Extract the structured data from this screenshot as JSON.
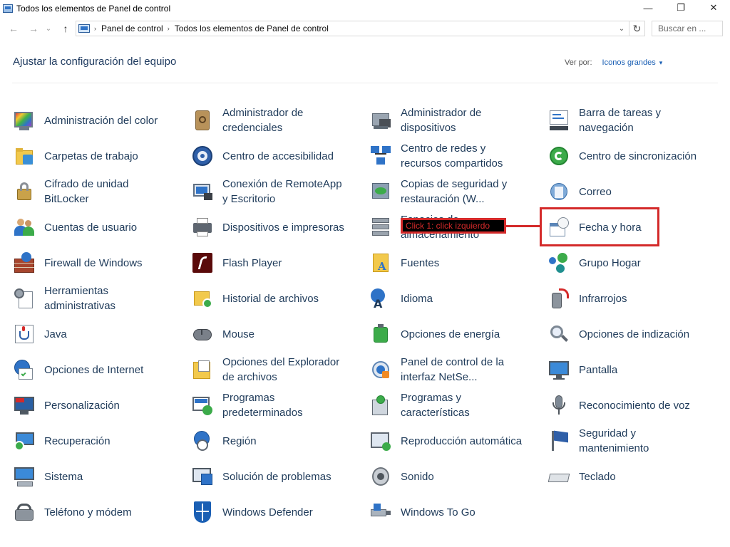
{
  "window": {
    "title": "Todos los elementos de Panel de control",
    "controls": {
      "minimize": "—",
      "maximize": "❐",
      "close": "✕"
    }
  },
  "nav": {
    "back": "←",
    "forward": "→",
    "recent": "⌄",
    "up": "↑"
  },
  "address": {
    "crumbs": [
      "Panel de control",
      "Todos los elementos de Panel de control"
    ],
    "separator": "›",
    "dropdown": "⌄",
    "refresh": "↻"
  },
  "search": {
    "placeholder": "Buscar en ..."
  },
  "header": {
    "title": "Ajustar la configuración del equipo",
    "view_by_label": "Ver por:",
    "view_by_value": "Iconos grandes",
    "caret": "▾"
  },
  "items": [
    {
      "label": "Administración del color",
      "icon": "color-management-icon"
    },
    {
      "label": "Administrador de credenciales",
      "icon": "credential-manager-icon"
    },
    {
      "label": "Administrador de dispositivos",
      "icon": "device-manager-icon"
    },
    {
      "label": "Barra de tareas y navegación",
      "icon": "taskbar-icon"
    },
    {
      "label": "Carpetas de trabajo",
      "icon": "work-folders-icon"
    },
    {
      "label": "Centro de accesibilidad",
      "icon": "accessibility-icon"
    },
    {
      "label": "Centro de redes y recursos compartidos",
      "icon": "network-center-icon"
    },
    {
      "label": "Centro de sincronización",
      "icon": "sync-center-icon"
    },
    {
      "label": "Cifrado de unidad BitLocker",
      "icon": "bitlocker-icon"
    },
    {
      "label": "Conexión de RemoteApp y Escritorio",
      "icon": "remoteapp-icon"
    },
    {
      "label": "Copias de seguridad y restauración (W...",
      "icon": "backup-icon"
    },
    {
      "label": "Correo",
      "icon": "mail-icon"
    },
    {
      "label": "Cuentas de usuario",
      "icon": "user-accounts-icon"
    },
    {
      "label": "Dispositivos e impresoras",
      "icon": "printer-icon"
    },
    {
      "label": "Espacios de almacenamiento",
      "icon": "storage-spaces-icon"
    },
    {
      "label": "Fecha y hora",
      "icon": "date-time-icon"
    },
    {
      "label": "Firewall de Windows",
      "icon": "firewall-icon"
    },
    {
      "label": "Flash Player",
      "icon": "flash-player-icon"
    },
    {
      "label": "Fuentes",
      "icon": "fonts-icon"
    },
    {
      "label": "Grupo Hogar",
      "icon": "homegroup-icon"
    },
    {
      "label": "Herramientas administrativas",
      "icon": "admin-tools-icon"
    },
    {
      "label": "Historial de archivos",
      "icon": "file-history-icon"
    },
    {
      "label": "Idioma",
      "icon": "language-icon"
    },
    {
      "label": "Infrarrojos",
      "icon": "infrared-icon"
    },
    {
      "label": "Java",
      "icon": "java-icon"
    },
    {
      "label": "Mouse",
      "icon": "mouse-icon"
    },
    {
      "label": "Opciones de energía",
      "icon": "power-options-icon"
    },
    {
      "label": "Opciones de indización",
      "icon": "indexing-icon"
    },
    {
      "label": "Opciones de Internet",
      "icon": "internet-options-icon"
    },
    {
      "label": "Opciones del Explorador de archivos",
      "icon": "explorer-options-icon"
    },
    {
      "label": "Panel de control de la interfaz NetSe...",
      "icon": "netsetup-icon"
    },
    {
      "label": "Pantalla",
      "icon": "display-icon"
    },
    {
      "label": "Personalización",
      "icon": "personalization-icon"
    },
    {
      "label": "Programas predeterminados",
      "icon": "default-programs-icon"
    },
    {
      "label": "Programas y características",
      "icon": "programs-features-icon"
    },
    {
      "label": "Reconocimiento de voz",
      "icon": "speech-icon"
    },
    {
      "label": "Recuperación",
      "icon": "recovery-icon"
    },
    {
      "label": "Región",
      "icon": "region-icon"
    },
    {
      "label": "Reproducción automática",
      "icon": "autoplay-icon"
    },
    {
      "label": "Seguridad y mantenimiento",
      "icon": "security-flag-icon"
    },
    {
      "label": "Sistema",
      "icon": "system-icon"
    },
    {
      "label": "Solución de problemas",
      "icon": "troubleshooting-icon"
    },
    {
      "label": "Sonido",
      "icon": "sound-icon"
    },
    {
      "label": "Teclado",
      "icon": "keyboard-icon"
    },
    {
      "label": "Teléfono y módem",
      "icon": "phone-modem-icon"
    },
    {
      "label": "Windows Defender",
      "icon": "windows-defender-icon"
    },
    {
      "label": "Windows To Go",
      "icon": "windows-to-go-icon"
    }
  ],
  "annotation": {
    "text": "Click 1: click izquierdo",
    "target": "Fecha y hora",
    "color": "#d42a2a"
  }
}
